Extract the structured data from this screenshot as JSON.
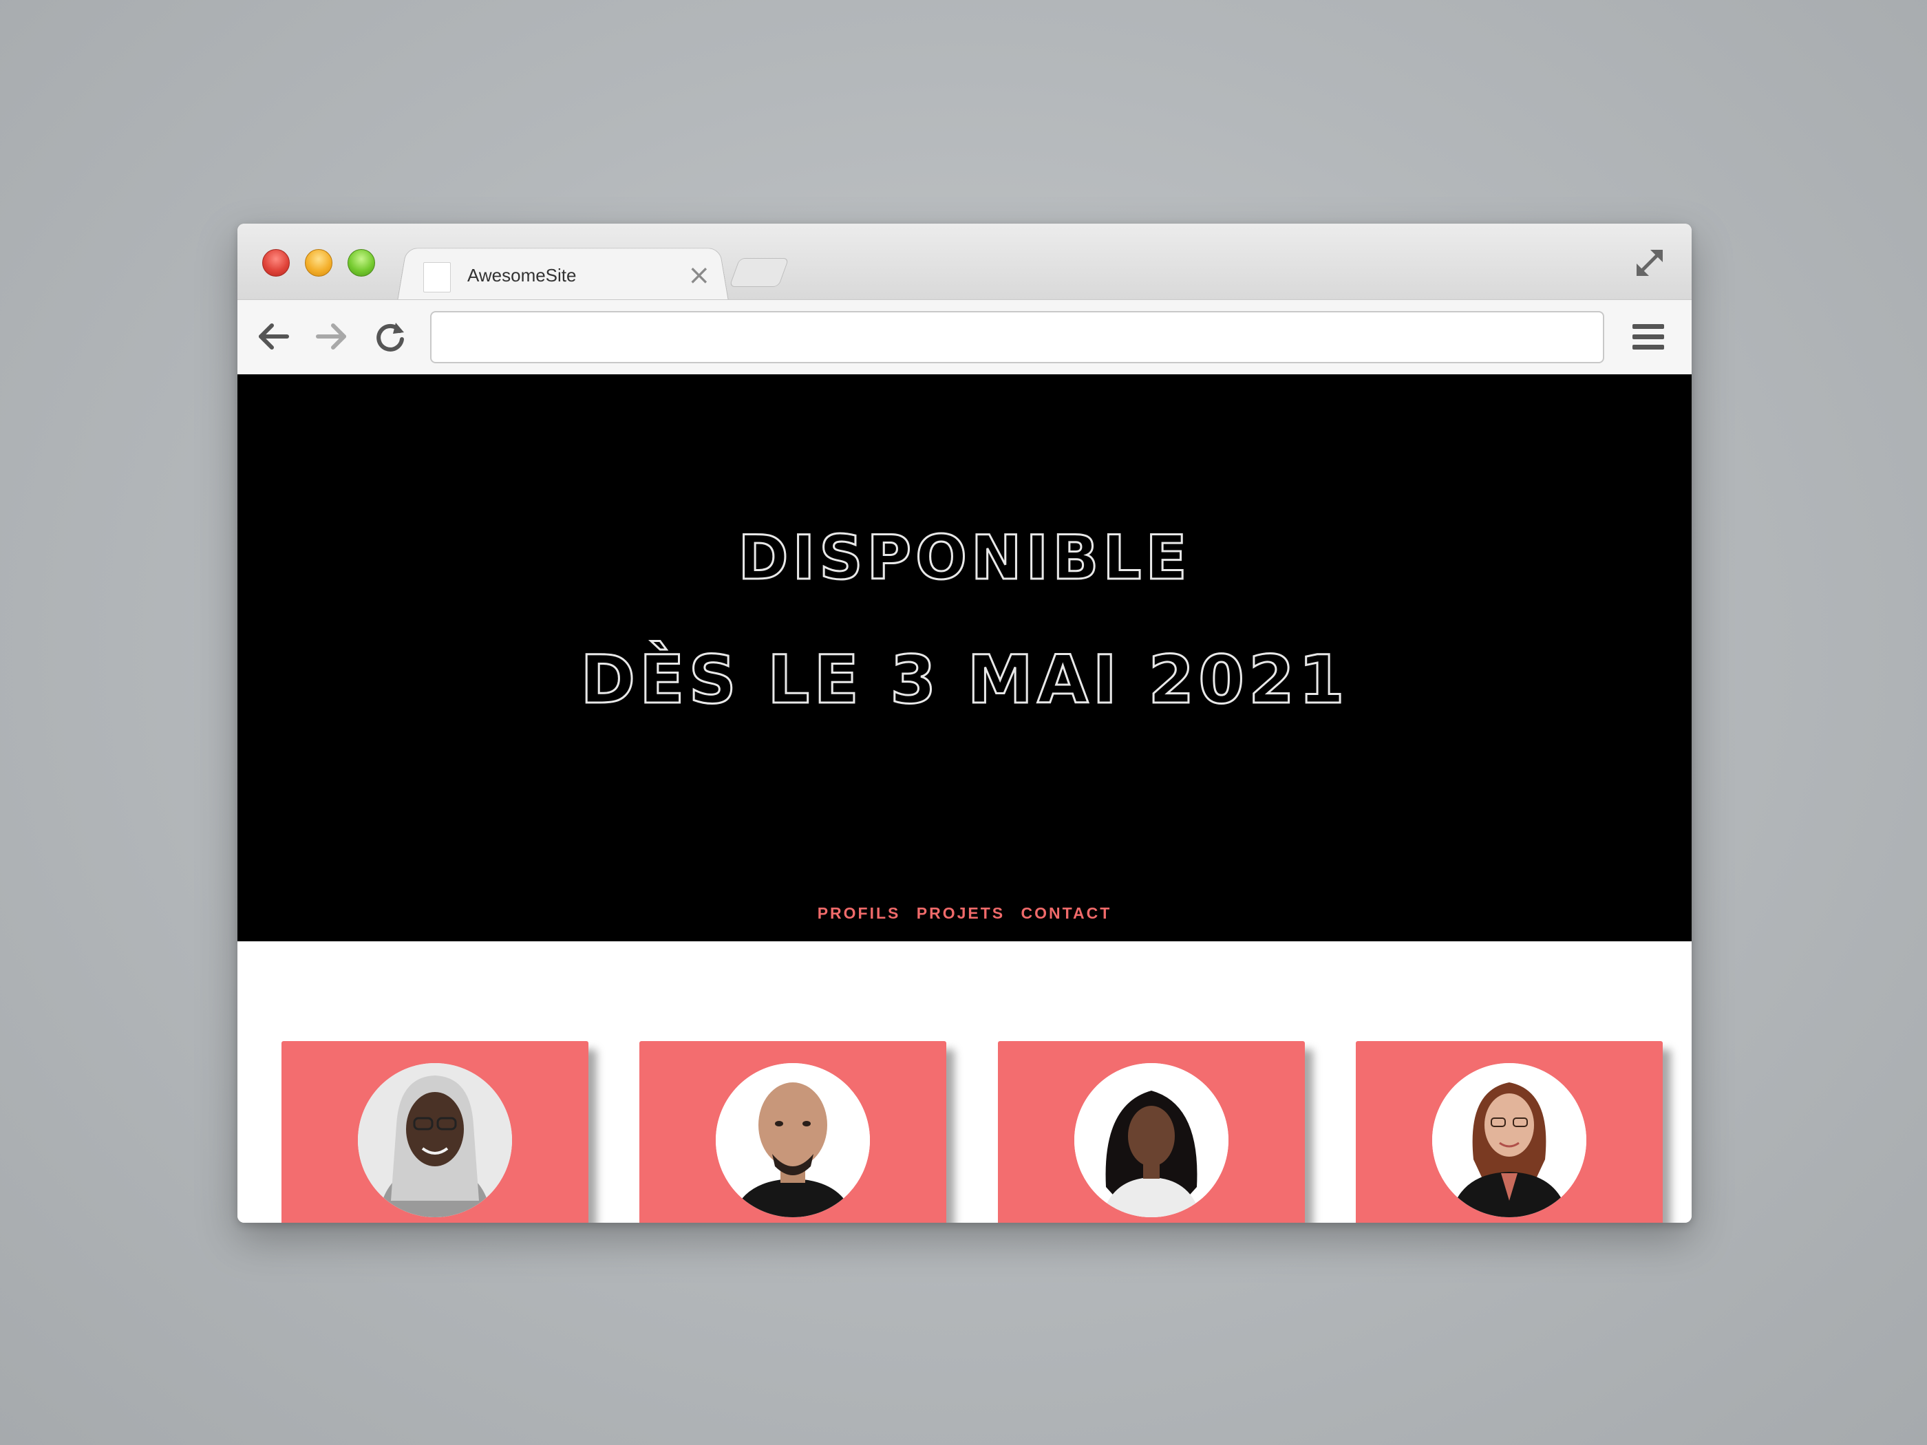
{
  "browser": {
    "tab_title": "AwesomeSite",
    "tab_close_glyph": "×",
    "url": "",
    "icons": {
      "back": "arrow-left-icon",
      "forward": "arrow-right-icon",
      "reload": "reload-icon",
      "menu": "hamburger-menu-icon",
      "expand": "fullscreen-icon"
    }
  },
  "hero": {
    "line1": "DISPONIBLE",
    "line2": "DÈS LE 3 MAI 2021"
  },
  "nav": {
    "profiles": "PROFILS",
    "projects": "PROJETS",
    "contact": "CONTACT"
  },
  "colors": {
    "hero_background": "#000000",
    "accent": "#f06a6a",
    "card_background": "#f36d6f"
  },
  "profiles": [
    {
      "avatar": "person-photo"
    },
    {
      "avatar": "person-photo"
    },
    {
      "avatar": "person-photo"
    },
    {
      "avatar": "person-photo"
    }
  ]
}
